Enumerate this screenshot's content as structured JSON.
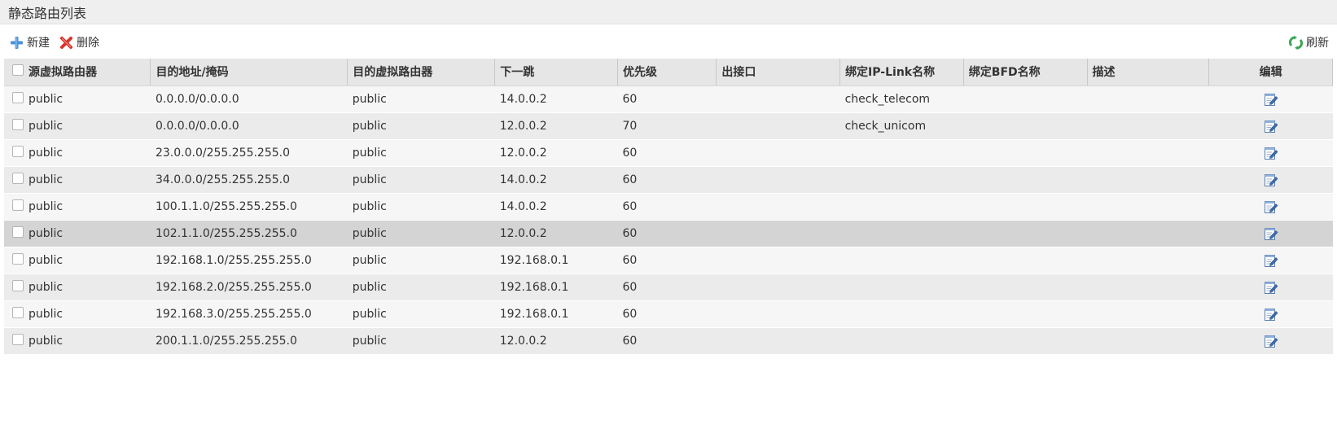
{
  "page_title": "静态路由列表",
  "toolbar": {
    "new_label": "新建",
    "delete_label": "删除",
    "refresh_label": "刷新"
  },
  "icons": {
    "new": "plus-icon",
    "delete": "delete-x-icon",
    "refresh": "refresh-icon",
    "edit": "edit-icon"
  },
  "colors": {
    "new_icon": "#4a90d9",
    "delete_icon": "#d9342b",
    "refresh_icon": "#3aa655"
  },
  "table": {
    "columns": [
      "源虚拟路由器",
      "目的地址/掩码",
      "目的虚拟路由器",
      "下一跳",
      "优先级",
      "出接口",
      "绑定IP-Link名称",
      "绑定BFD名称",
      "描述",
      "编辑"
    ],
    "rows": [
      {
        "src_vr": "public",
        "dest": "0.0.0.0/0.0.0.0",
        "dest_vr": "public",
        "next_hop": "14.0.0.2",
        "priority": "60",
        "out_if": "",
        "ip_link": "check_telecom",
        "bfd": "",
        "desc": ""
      },
      {
        "src_vr": "public",
        "dest": "0.0.0.0/0.0.0.0",
        "dest_vr": "public",
        "next_hop": "12.0.0.2",
        "priority": "70",
        "out_if": "",
        "ip_link": "check_unicom",
        "bfd": "",
        "desc": ""
      },
      {
        "src_vr": "public",
        "dest": "23.0.0.0/255.255.255.0",
        "dest_vr": "public",
        "next_hop": "12.0.0.2",
        "priority": "60",
        "out_if": "",
        "ip_link": "",
        "bfd": "",
        "desc": ""
      },
      {
        "src_vr": "public",
        "dest": "34.0.0.0/255.255.255.0",
        "dest_vr": "public",
        "next_hop": "14.0.0.2",
        "priority": "60",
        "out_if": "",
        "ip_link": "",
        "bfd": "",
        "desc": ""
      },
      {
        "src_vr": "public",
        "dest": "100.1.1.0/255.255.255.0",
        "dest_vr": "public",
        "next_hop": "14.0.0.2",
        "priority": "60",
        "out_if": "",
        "ip_link": "",
        "bfd": "",
        "desc": ""
      },
      {
        "src_vr": "public",
        "dest": "102.1.1.0/255.255.255.0",
        "dest_vr": "public",
        "next_hop": "12.0.0.2",
        "priority": "60",
        "out_if": "",
        "ip_link": "",
        "bfd": "",
        "desc": "",
        "selected": true
      },
      {
        "src_vr": "public",
        "dest": "192.168.1.0/255.255.255.0",
        "dest_vr": "public",
        "next_hop": "192.168.0.1",
        "priority": "60",
        "out_if": "",
        "ip_link": "",
        "bfd": "",
        "desc": ""
      },
      {
        "src_vr": "public",
        "dest": "192.168.2.0/255.255.255.0",
        "dest_vr": "public",
        "next_hop": "192.168.0.1",
        "priority": "60",
        "out_if": "",
        "ip_link": "",
        "bfd": "",
        "desc": ""
      },
      {
        "src_vr": "public",
        "dest": "192.168.3.0/255.255.255.0",
        "dest_vr": "public",
        "next_hop": "192.168.0.1",
        "priority": "60",
        "out_if": "",
        "ip_link": "",
        "bfd": "",
        "desc": ""
      },
      {
        "src_vr": "public",
        "dest": "200.1.1.0/255.255.255.0",
        "dest_vr": "public",
        "next_hop": "12.0.0.2",
        "priority": "60",
        "out_if": "",
        "ip_link": "",
        "bfd": "",
        "desc": ""
      }
    ]
  }
}
